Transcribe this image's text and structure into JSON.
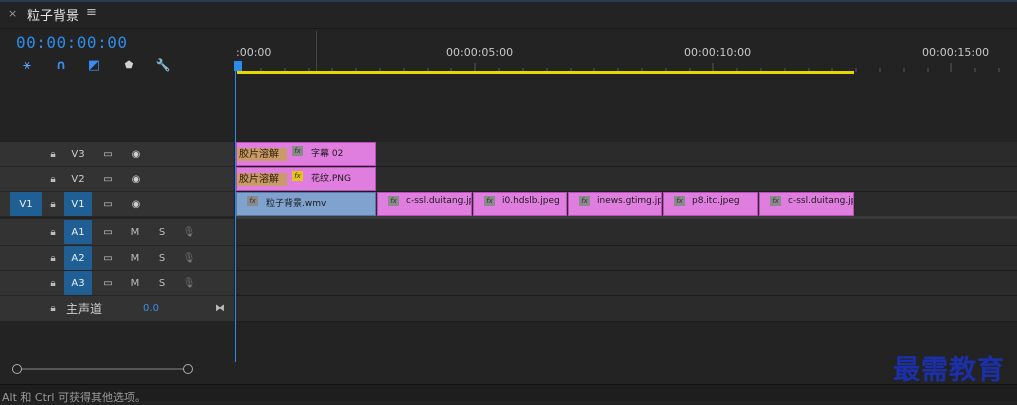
{
  "panel": {
    "close": "×",
    "title": "粒子背景",
    "menu": "≡"
  },
  "header": {
    "timecode": "00:00:00:00"
  },
  "tools": [
    {
      "name": "snap-icon",
      "glyph": "⚹",
      "color": "#5aa0ff"
    },
    {
      "name": "linked-selection-icon",
      "glyph": "∩",
      "color": "#3b8cf0"
    },
    {
      "name": "add-marker-icon",
      "glyph": "◩",
      "color": "#3b8cf0"
    },
    {
      "name": "marker-icon",
      "glyph": "⬟",
      "color": "#d0d0d0"
    },
    {
      "name": "wrench-icon",
      "glyph": "🔧",
      "color": "#d0d0d0"
    }
  ],
  "ruler": {
    "labels": [
      ":00:00",
      "00:00:05:00",
      "00:00:10:00",
      "00:00:15:00"
    ]
  },
  "tracks": {
    "v3": {
      "label": "V3"
    },
    "v2": {
      "label": "V2"
    },
    "v1": {
      "label": "V1",
      "source": "V1"
    },
    "a1": {
      "label": "A1",
      "m": "M",
      "s": "S"
    },
    "a2": {
      "label": "A2",
      "m": "M",
      "s": "S"
    },
    "a3": {
      "label": "A3",
      "m": "M",
      "s": "S"
    },
    "master": {
      "label": "主声道",
      "value": "0.0"
    }
  },
  "clips": {
    "v3": {
      "transition": "胶片溶解",
      "fx": "fx",
      "label": "字幕 02"
    },
    "v2": {
      "transition": "胶片溶解",
      "fx": "fx",
      "label": "花纹.PNG"
    },
    "v1": [
      {
        "fx": "fx",
        "label": "粒子背景.wmv"
      },
      {
        "fx": "fx",
        "label": "c-ssl.duitang.jpe"
      },
      {
        "fx": "fx",
        "label": "i0.hdslb.jpeg"
      },
      {
        "fx": "fx",
        "label": "inews.gtimg.jpe"
      },
      {
        "fx": "fx",
        "label": "p8.itc.jpeg"
      },
      {
        "fx": "fx",
        "label": "c-ssl.duitang.jp"
      }
    ]
  },
  "status": {
    "text": "Alt 和 Ctrl 可获得其他选项。"
  },
  "watermark": {
    "text": "最需教育"
  }
}
